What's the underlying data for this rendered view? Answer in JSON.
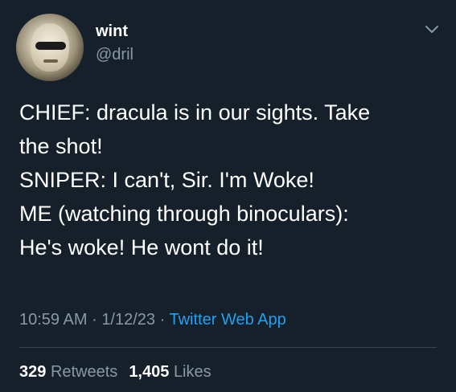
{
  "user": {
    "display_name": "wint",
    "handle": "@dril"
  },
  "tweet": {
    "lines": [
      "CHIEF: dracula is in our sights. Take",
      "the shot!",
      "SNIPER: I can't, Sir. I'm Woke!",
      "ME (watching through binoculars):",
      "He's woke! He wont do it!"
    ],
    "time": "10:59 AM",
    "date": "1/12/23",
    "source": "Twitter Web App",
    "separator": "·"
  },
  "stats": {
    "retweets_count": "329",
    "retweets_label": "Retweets",
    "likes_count": "1,405",
    "likes_label": "Likes"
  },
  "icons": {
    "menu": "chevron-down-icon"
  },
  "colors": {
    "background": "#15202b",
    "text": "#ffffff",
    "secondary_text": "#8899a6",
    "link": "#1da1f2",
    "divider": "#38444d"
  }
}
